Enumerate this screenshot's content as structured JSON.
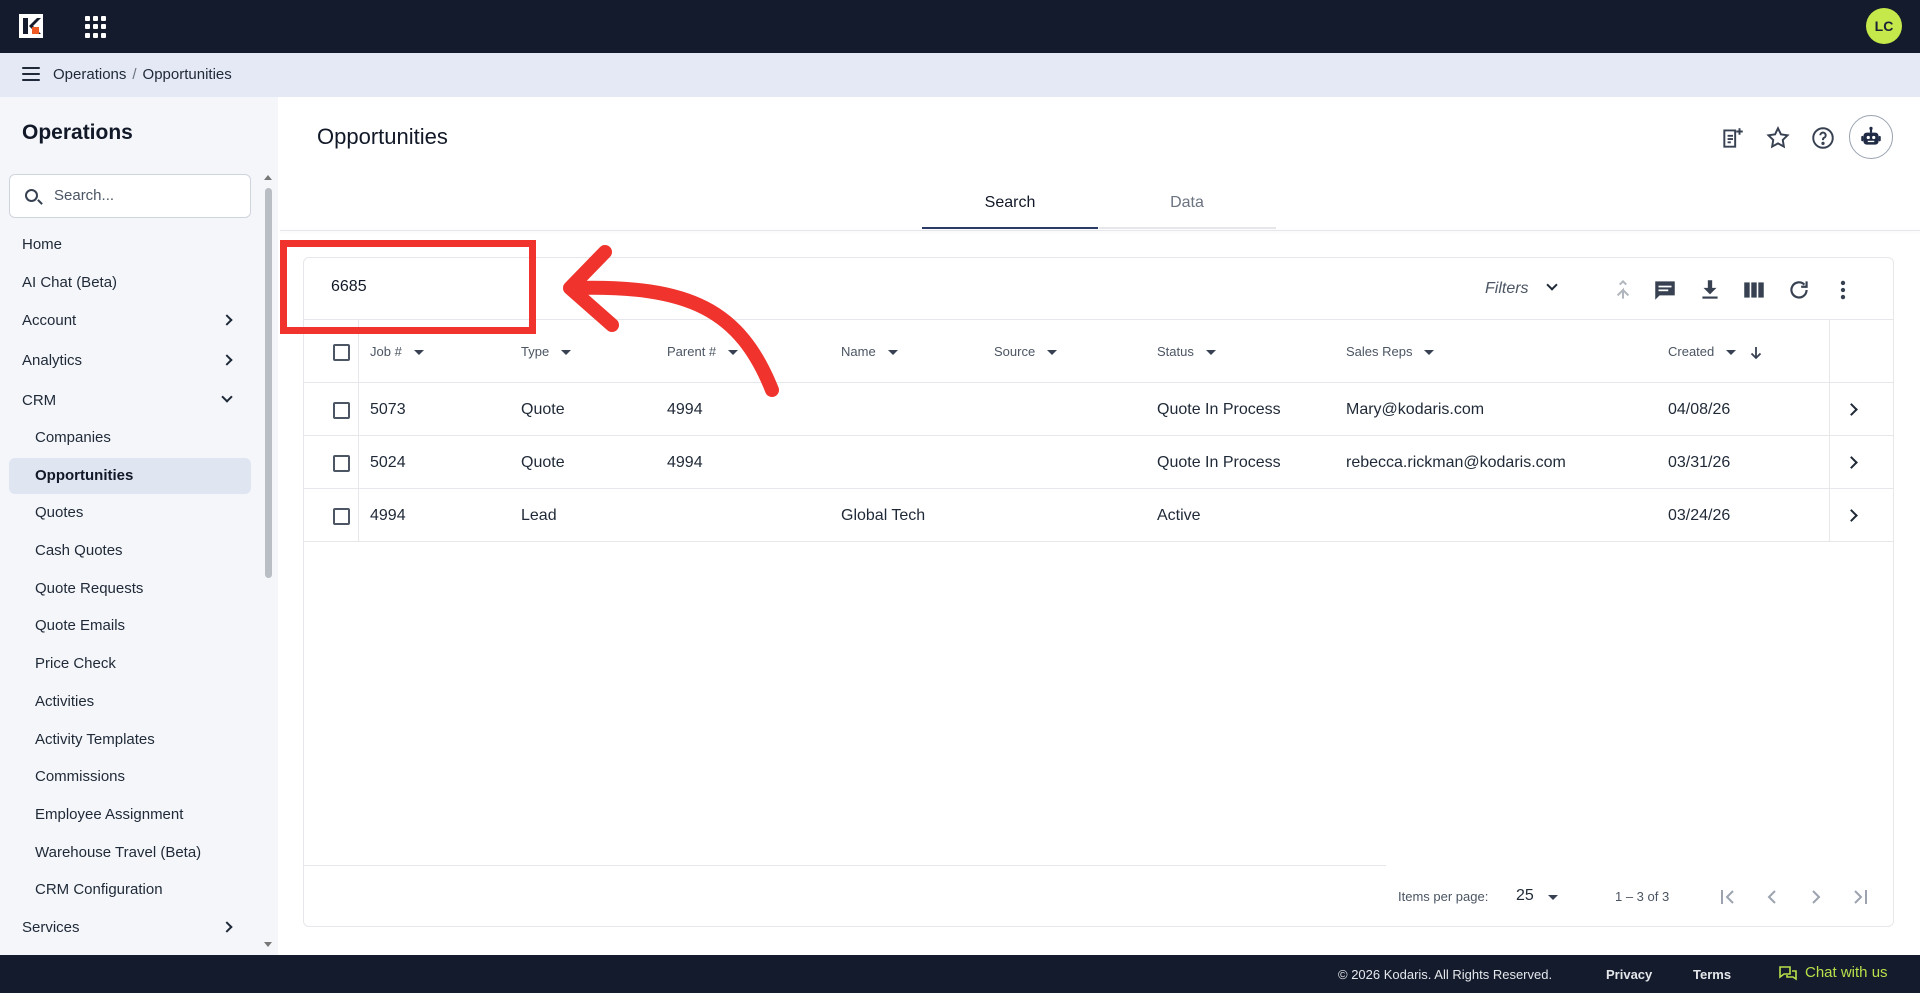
{
  "header": {
    "avatar_initials": "LC"
  },
  "breadcrumb": {
    "section": "Operations",
    "separator": "/",
    "page": "Opportunities"
  },
  "sidebar": {
    "title": "Operations",
    "search_placeholder": "Search...",
    "items": [
      {
        "label": "Home"
      },
      {
        "label": "AI Chat (Beta)"
      },
      {
        "label": "Account"
      },
      {
        "label": "Analytics"
      },
      {
        "label": "CRM"
      }
    ],
    "crm_items": [
      {
        "label": "Companies"
      },
      {
        "label": "Opportunities"
      },
      {
        "label": "Quotes"
      },
      {
        "label": "Cash Quotes"
      },
      {
        "label": "Quote Requests"
      },
      {
        "label": "Quote Emails"
      },
      {
        "label": "Price Check"
      },
      {
        "label": "Activities"
      },
      {
        "label": "Activity Templates"
      },
      {
        "label": "Commissions"
      },
      {
        "label": "Employee Assignment"
      },
      {
        "label": "Warehouse Travel (Beta)"
      },
      {
        "label": "CRM Configuration"
      }
    ],
    "services_label": "Services"
  },
  "main": {
    "title": "Opportunities",
    "tabs": [
      {
        "label": "Search"
      },
      {
        "label": "Data"
      }
    ],
    "search_value": "6685",
    "filters_label": "Filters",
    "columns": [
      "Job #",
      "Type",
      "Parent #",
      "Name",
      "Source",
      "Status",
      "Sales Reps",
      "Created"
    ],
    "rows": [
      {
        "job": "5073",
        "type": "Quote",
        "parent": "4994",
        "name": "",
        "source": "",
        "status": "Quote In Process",
        "reps": "Mary@kodaris.com",
        "created": "04/08/26"
      },
      {
        "job": "5024",
        "type": "Quote",
        "parent": "4994",
        "name": "",
        "source": "",
        "status": "Quote In Process",
        "reps": "rebecca.rickman@kodaris.com",
        "created": "03/31/26"
      },
      {
        "job": "4994",
        "type": "Lead",
        "parent": "",
        "name": "Global Tech",
        "source": "",
        "status": "Active",
        "reps": "",
        "created": "03/24/26"
      }
    ],
    "pagination": {
      "items_per_page_label": "Items per page:",
      "items_per_page": "25",
      "range": "1 – 3 of 3"
    }
  },
  "footer": {
    "copyright": "© 2026 Kodaris. All Rights Reserved.",
    "privacy": "Privacy",
    "terms": "Terms",
    "chat": "Chat with us"
  },
  "colors": {
    "accent": "#2b3a67",
    "annotation": "#f0332c",
    "topbar": "#141b2d",
    "chat": "#b7e04a"
  }
}
